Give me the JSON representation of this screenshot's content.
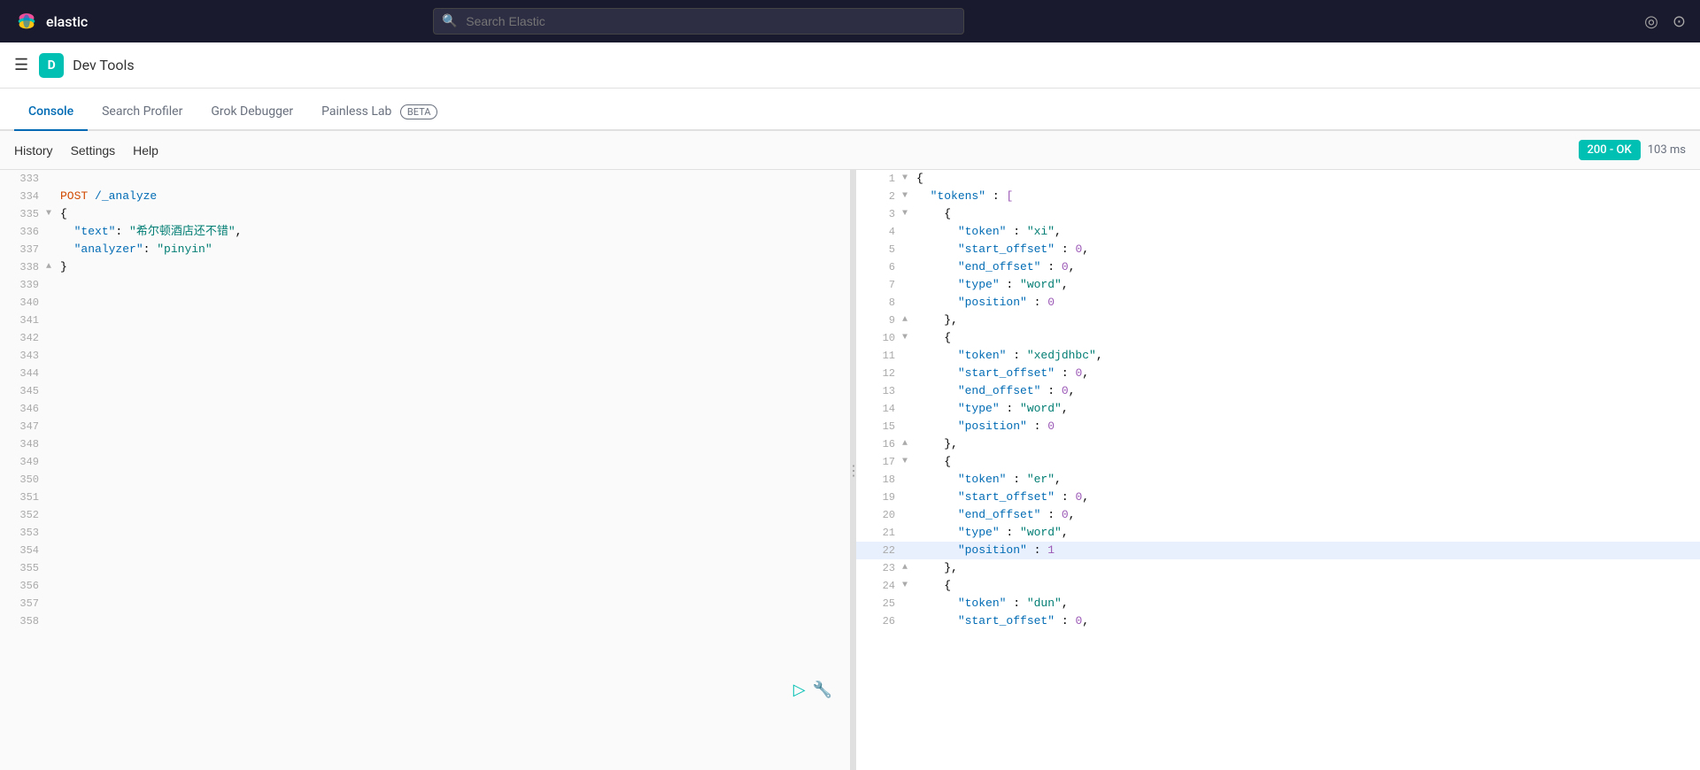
{
  "topNav": {
    "logo": "elastic",
    "search": {
      "placeholder": "Search Elastic"
    },
    "icons": {
      "circle": "○",
      "person": "⊙"
    }
  },
  "secondBar": {
    "appIcon": "D",
    "appTitle": "Dev Tools"
  },
  "tabs": [
    {
      "id": "console",
      "label": "Console",
      "active": true
    },
    {
      "id": "search-profiler",
      "label": "Search Profiler",
      "active": false
    },
    {
      "id": "grok-debugger",
      "label": "Grok Debugger",
      "active": false
    },
    {
      "id": "painless-lab",
      "label": "Painless Lab",
      "active": false,
      "beta": true
    }
  ],
  "toolbar": {
    "history": "History",
    "settings": "Settings",
    "help": "Help",
    "status": "200 - OK",
    "time": "103 ms"
  },
  "leftPane": {
    "lines": [
      {
        "num": "333",
        "arrow": "",
        "content": ""
      },
      {
        "num": "334",
        "arrow": "",
        "method": "POST",
        "path": " /_analyze"
      },
      {
        "num": "335",
        "arrow": "▼",
        "content": "{"
      },
      {
        "num": "336",
        "arrow": "",
        "indent": "  ",
        "key": "\"text\"",
        "colon": ": ",
        "value": "\"希尔顿酒店还不错\"",
        "comma": ","
      },
      {
        "num": "337",
        "arrow": "",
        "indent": "  ",
        "key": "\"analyzer\"",
        "colon": ": ",
        "value": "\"pinyin\""
      },
      {
        "num": "338",
        "arrow": "▲",
        "content": "}"
      },
      {
        "num": "339",
        "arrow": ""
      },
      {
        "num": "340",
        "arrow": ""
      },
      {
        "num": "341",
        "arrow": ""
      },
      {
        "num": "342",
        "arrow": ""
      },
      {
        "num": "343",
        "arrow": ""
      },
      {
        "num": "344",
        "arrow": ""
      },
      {
        "num": "345",
        "arrow": ""
      },
      {
        "num": "346",
        "arrow": ""
      },
      {
        "num": "347",
        "arrow": ""
      },
      {
        "num": "348",
        "arrow": ""
      },
      {
        "num": "349",
        "arrow": ""
      },
      {
        "num": "350",
        "arrow": ""
      },
      {
        "num": "351",
        "arrow": ""
      },
      {
        "num": "352",
        "arrow": ""
      },
      {
        "num": "353",
        "arrow": ""
      },
      {
        "num": "354",
        "arrow": ""
      },
      {
        "num": "355",
        "arrow": ""
      },
      {
        "num": "356",
        "arrow": ""
      },
      {
        "num": "357",
        "arrow": ""
      },
      {
        "num": "358",
        "arrow": ""
      }
    ]
  },
  "rightPane": {
    "lines": [
      {
        "num": "1",
        "arrow": "▼",
        "content": "{",
        "highlighted": false
      },
      {
        "num": "2",
        "arrow": "▼",
        "indent": "  ",
        "key": "\"tokens\"",
        "colon": " : ",
        "value": "[",
        "highlighted": false
      },
      {
        "num": "3",
        "arrow": "▼",
        "indent": "    ",
        "content": "{",
        "highlighted": false
      },
      {
        "num": "4",
        "arrow": "",
        "indent": "      ",
        "key": "\"token\"",
        "colon": " : ",
        "value": "\"xi\"",
        "comma": ",",
        "highlighted": false
      },
      {
        "num": "5",
        "arrow": "",
        "indent": "      ",
        "key": "\"start_offset\"",
        "colon": " : ",
        "value": "0",
        "comma": ",",
        "highlighted": false
      },
      {
        "num": "6",
        "arrow": "",
        "indent": "      ",
        "key": "\"end_offset\"",
        "colon": " : ",
        "value": "0",
        "comma": ",",
        "highlighted": false
      },
      {
        "num": "7",
        "arrow": "",
        "indent": "      ",
        "key": "\"type\"",
        "colon": " : ",
        "value": "\"word\"",
        "comma": ",",
        "highlighted": false
      },
      {
        "num": "8",
        "arrow": "",
        "indent": "      ",
        "key": "\"position\"",
        "colon": " : ",
        "value": "0",
        "highlighted": false
      },
      {
        "num": "9",
        "arrow": "▲",
        "indent": "    ",
        "content": "},",
        "highlighted": false
      },
      {
        "num": "10",
        "arrow": "▼",
        "indent": "    ",
        "content": "{",
        "highlighted": false
      },
      {
        "num": "11",
        "arrow": "",
        "indent": "      ",
        "key": "\"token\"",
        "colon": " : ",
        "value": "\"xedjdhbc\"",
        "comma": ",",
        "highlighted": false
      },
      {
        "num": "12",
        "arrow": "",
        "indent": "      ",
        "key": "\"start_offset\"",
        "colon": " : ",
        "value": "0",
        "comma": ",",
        "highlighted": false
      },
      {
        "num": "13",
        "arrow": "",
        "indent": "      ",
        "key": "\"end_offset\"",
        "colon": " : ",
        "value": "0",
        "comma": ",",
        "highlighted": false
      },
      {
        "num": "14",
        "arrow": "",
        "indent": "      ",
        "key": "\"type\"",
        "colon": " : ",
        "value": "\"word\"",
        "comma": ",",
        "highlighted": false
      },
      {
        "num": "15",
        "arrow": "",
        "indent": "      ",
        "key": "\"position\"",
        "colon": " : ",
        "value": "0",
        "highlighted": false
      },
      {
        "num": "16",
        "arrow": "▲",
        "indent": "    ",
        "content": "},",
        "highlighted": false
      },
      {
        "num": "17",
        "arrow": "▼",
        "indent": "    ",
        "content": "{",
        "highlighted": false
      },
      {
        "num": "18",
        "arrow": "",
        "indent": "      ",
        "key": "\"token\"",
        "colon": " : ",
        "value": "\"er\"",
        "comma": ",",
        "highlighted": false
      },
      {
        "num": "19",
        "arrow": "",
        "indent": "      ",
        "key": "\"start_offset\"",
        "colon": " : ",
        "value": "0",
        "comma": ",",
        "highlighted": false
      },
      {
        "num": "20",
        "arrow": "",
        "indent": "      ",
        "key": "\"end_offset\"",
        "colon": " : ",
        "value": "0",
        "comma": ",",
        "highlighted": false
      },
      {
        "num": "21",
        "arrow": "",
        "indent": "      ",
        "key": "\"type\"",
        "colon": " : ",
        "value": "\"word\"",
        "comma": ",",
        "highlighted": false
      },
      {
        "num": "22",
        "arrow": "",
        "indent": "      ",
        "key": "\"position\"",
        "colon": " : ",
        "value": "1",
        "highlighted": true
      },
      {
        "num": "23",
        "arrow": "▲",
        "indent": "    ",
        "content": "},",
        "highlighted": false
      },
      {
        "num": "24",
        "arrow": "▼",
        "indent": "    ",
        "content": "{",
        "highlighted": false
      },
      {
        "num": "25",
        "arrow": "",
        "indent": "      ",
        "key": "\"token\"",
        "colon": " : ",
        "value": "\"dun\"",
        "comma": ",",
        "highlighted": false
      },
      {
        "num": "26",
        "arrow": "",
        "indent": "      ",
        "key": "\"start_offset\"",
        "colon": " : ",
        "value": "0",
        "comma": ",",
        "highlighted": false
      }
    ]
  },
  "colors": {
    "accent": "#006bb4",
    "teal": "#00bfb3",
    "method_post": "#d04a02"
  }
}
